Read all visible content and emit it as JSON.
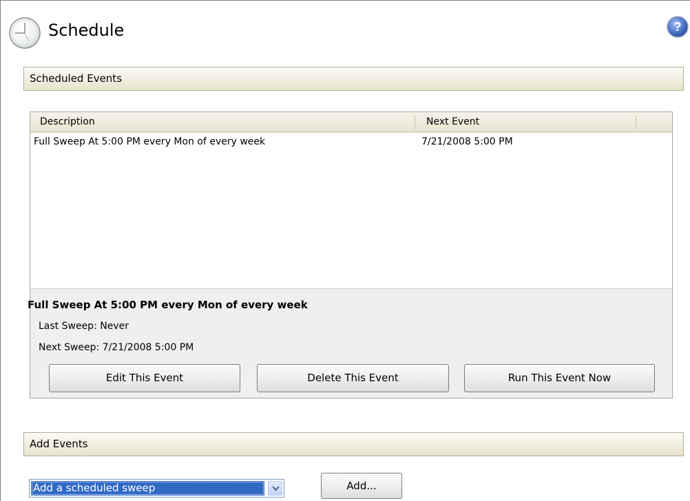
{
  "page": {
    "title": "Schedule",
    "icon": "clock-icon",
    "help_icon": "help-icon"
  },
  "scheduled_events": {
    "section_title": "Scheduled Events",
    "columns": [
      "Description",
      "Next Event"
    ],
    "rows": [
      {
        "description": "Full Sweep At 5:00 PM every Mon of every week",
        "next_event": "7/21/2008 5:00 PM"
      }
    ],
    "detail": {
      "title": "Full Sweep At 5:00 PM every Mon of every week",
      "last_sweep": "Last Sweep: Never",
      "next_sweep": "Next Sweep: 7/21/2008 5:00 PM"
    },
    "buttons": {
      "edit": "Edit This Event",
      "delete": "Delete This Event",
      "run": "Run This Event Now"
    }
  },
  "add_events": {
    "section_title": "Add Events",
    "select_value": "Add a scheduled sweep",
    "add_button": "Add..."
  },
  "colors": {
    "section_bar_bg": "#f0eedf",
    "selection_highlight": "#316ac5",
    "panel_bg": "#efefef"
  }
}
